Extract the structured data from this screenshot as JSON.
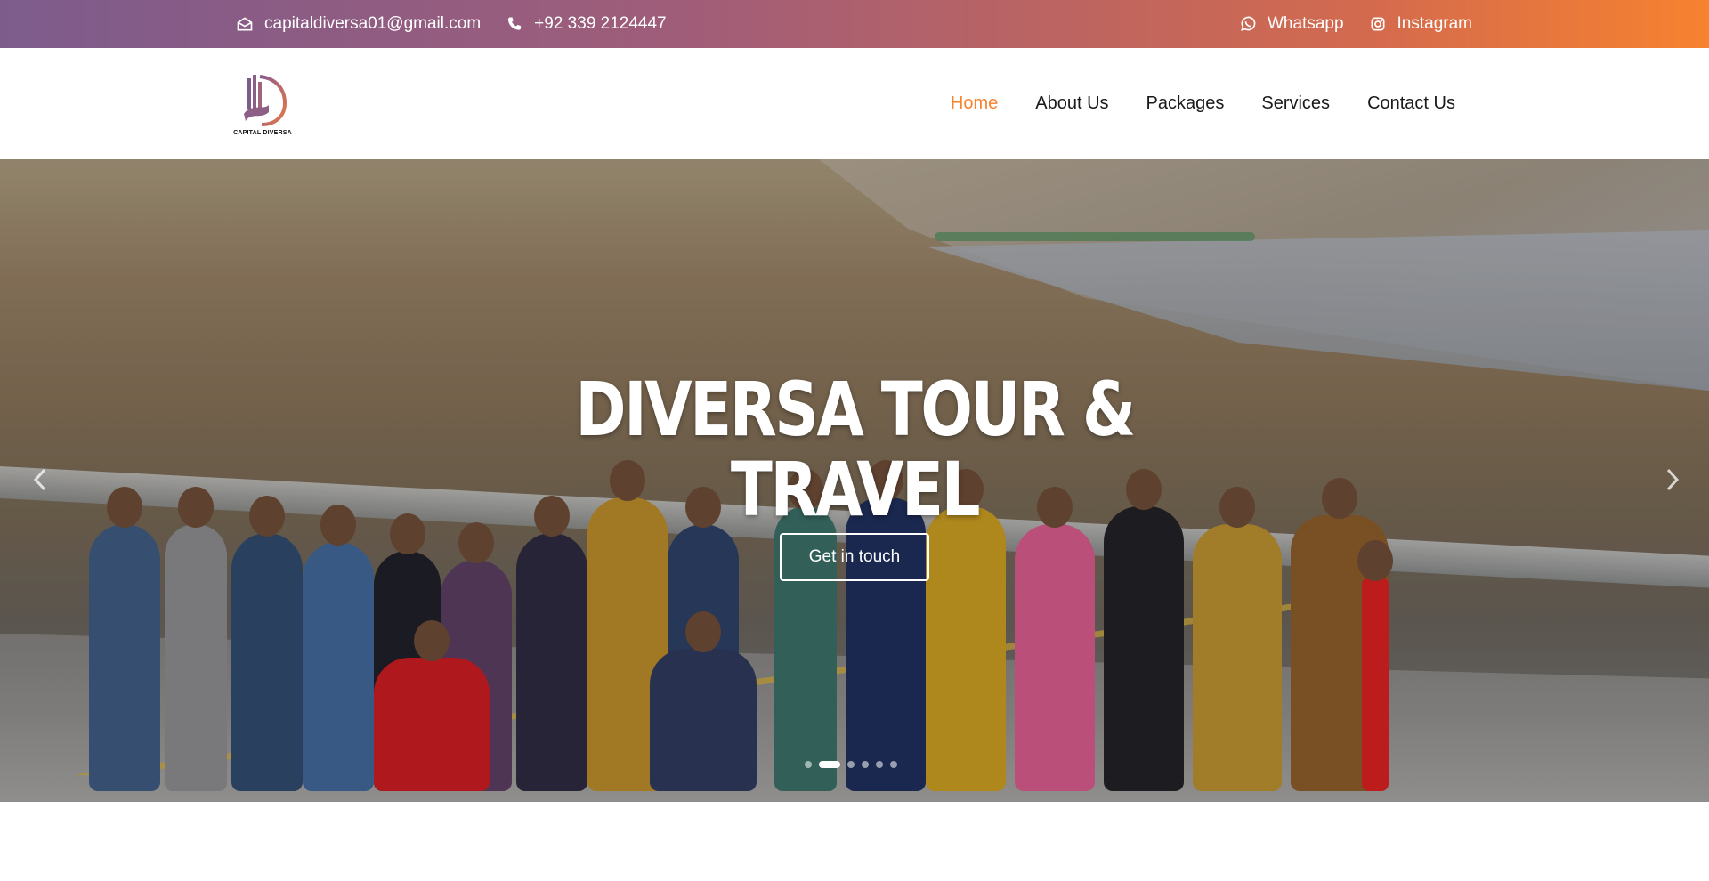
{
  "topbar": {
    "email": "capitaldiversa01@gmail.com",
    "phone": "+92 339 2124447",
    "whatsapp_label": "Whatsapp",
    "instagram_label": "Instagram",
    "icons": [
      "envelope-icon",
      "phone-icon",
      "whatsapp-icon",
      "instagram-icon"
    ]
  },
  "brand": {
    "logo_text": "CAPITAL DIVERSA"
  },
  "nav": {
    "items": [
      {
        "label": "Home",
        "active": true
      },
      {
        "label": "About Us",
        "active": false
      },
      {
        "label": "Packages",
        "active": false
      },
      {
        "label": "Services",
        "active": false
      },
      {
        "label": "Contact Us",
        "active": false
      }
    ]
  },
  "hero": {
    "title_line1": "DIVERSA TOUR &",
    "title_line2": "TRAVEL",
    "cta_label": "Get in touch",
    "slide_count": 6,
    "active_slide": 2
  },
  "colors": {
    "accent": "#f7822f",
    "gradient_start": "#7d5c8c",
    "gradient_end": "#f7822f"
  }
}
